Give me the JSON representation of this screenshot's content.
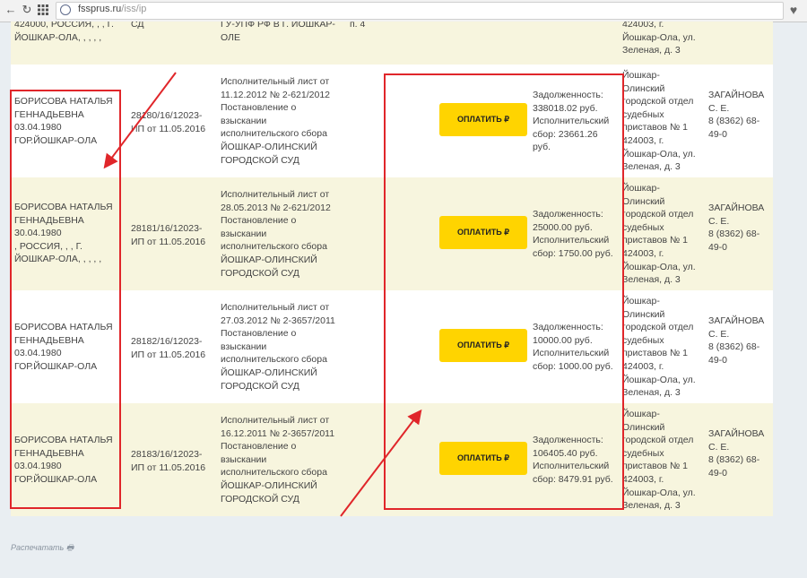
{
  "browser": {
    "url_host": "fssprus.ru",
    "url_path": "/iss/ip"
  },
  "top_partial": {
    "debtor": "424000, РОССИЯ, , , Г.\nЙОШКАР-ОЛА, , , , ,",
    "number": "СД",
    "doc": "ГУ-УПФ РФ В Г. ЙОШКАР-\nОЛЕ",
    "subject": "п. 4",
    "dept": "424003, г.\nЙошкар-Ола, ул.\nЗеленая, д. 3"
  },
  "rows": [
    {
      "debtor": "БОРИСОВА НАТАЛЬЯ\nГЕННАДЬЕВНА\n03.04.1980\nГОР.ЙОШКАР-ОЛА",
      "number": "28180/16/12023-\nИП от 11.05.2016",
      "doc": "Исполнительный лист от\n11.12.2012 № 2-621/2012\nПостановление о\nвзыскании\nисполнительского сбора\nЙОШКАР-ОЛИНСКИЙ\nГОРОДСКОЙ СУД",
      "pay_label": "ОПЛАТИТЬ ₽",
      "subject": "Задолженность:\n338018.02 руб.\nИсполнительский\nсбор: 23661.26\nруб.",
      "dept": "Йошкар-\nОлинский\nгородской отдел\nсудебных\nприставов № 1\n424003, г.\nЙошкар-Ола, ул.\nЗеленая, д. 3",
      "officer": "ЗАГАЙНОВА\nС. Е.\n8 (8362) 68-\n49-0"
    },
    {
      "debtor": "БОРИСОВА НАТАЛЬЯ\nГЕННАДЬЕВНА\n30.04.1980\n, РОССИЯ, , , Г.\nЙОШКАР-ОЛА, , , , ,",
      "number": "28181/16/12023-\nИП от 11.05.2016",
      "doc": "Исполнительный лист от\n28.05.2013 № 2-621/2012\nПостановление о\nвзыскании\nисполнительского сбора\nЙОШКАР-ОЛИНСКИЙ\nГОРОДСКОЙ СУД",
      "pay_label": "ОПЛАТИТЬ ₽",
      "subject": "Задолженность:\n25000.00 руб.\nИсполнительский\nсбор: 1750.00 руб.",
      "dept": "Йошкар-\nОлинский\nгородской отдел\nсудебных\nприставов № 1\n424003, г.\nЙошкар-Ола, ул.\nЗеленая, д. 3",
      "officer": "ЗАГАЙНОВА\nС. Е.\n8 (8362) 68-\n49-0"
    },
    {
      "debtor": "БОРИСОВА НАТАЛЬЯ\nГЕННАДЬЕВНА\n03.04.1980\nГОР.ЙОШКАР-ОЛА",
      "number": "28182/16/12023-\nИП от 11.05.2016",
      "doc": "Исполнительный лист от\n27.03.2012 № 2-3657/2011\nПостановление о\nвзыскании\nисполнительского сбора\nЙОШКАР-ОЛИНСКИЙ\nГОРОДСКОЙ СУД",
      "pay_label": "ОПЛАТИТЬ ₽",
      "subject": "Задолженность:\n10000.00 руб.\nИсполнительский\nсбор: 1000.00 руб.",
      "dept": "Йошкар-\nОлинский\nгородской отдел\nсудебных\nприставов № 1\n424003, г.\nЙошкар-Ола, ул.\nЗеленая, д. 3",
      "officer": "ЗАГАЙНОВА\nС. Е.\n8 (8362) 68-\n49-0"
    },
    {
      "debtor": "БОРИСОВА НАТАЛЬЯ\nГЕННАДЬЕВНА\n03.04.1980\nГОР.ЙОШКАР-ОЛА",
      "number": "28183/16/12023-\nИП от 11.05.2016",
      "doc": "Исполнительный лист от\n16.12.2011 № 2-3657/2011\nПостановление о\nвзыскании\nисполнительского сбора\nЙОШКАР-ОЛИНСКИЙ\nГОРОДСКОЙ СУД",
      "pay_label": "ОПЛАТИТЬ ₽",
      "subject": "Задолженность:\n106405.40 руб.\nИсполнительский\nсбор: 8479.91 руб.",
      "dept": "Йошкар-\nОлинский\nгородской отдел\nсудебных\nприставов № 1\n424003, г.\nЙошкар-Ола, ул.\nЗеленая, д. 3",
      "officer": "ЗАГАЙНОВА\nС. Е.\n8 (8362) 68-\n49-0"
    }
  ],
  "footer": {
    "print_label": "Распечатать"
  },
  "annotation_color": "#e0262a",
  "pay_color": "#ffd400"
}
